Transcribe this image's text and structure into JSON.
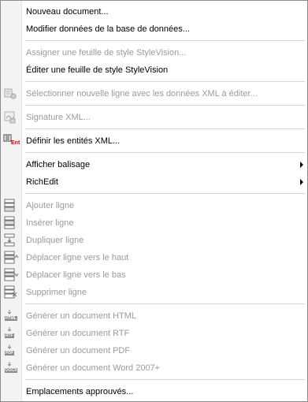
{
  "menu": {
    "new_document": "Nouveau document...",
    "edit_db_data": "Modifier données de la base de données...",
    "assign_stylesheet": "Assigner une feuille de style StyleVision...",
    "edit_stylesheet": "Éditer une feuille de style StyleVision",
    "select_new_row": "Sélectionner nouvelle ligne avec les données XML à éditer...",
    "signature": "Signature XML...",
    "define_entities": "Définir les entités XML...",
    "show_markup": "Afficher balisage",
    "richedit": "RichEdit",
    "add_row": "Ajouter ligne",
    "insert_row": "Insérer ligne",
    "duplicate_row": "Dupliquer ligne",
    "move_row_up": "Déplacer ligne vers le haut",
    "move_row_down": "Déplacer ligne vers le bas",
    "delete_row": "Supprimer ligne",
    "gen_html": "Générer un document HTML",
    "gen_rtf": "Générer un document RTF",
    "gen_pdf": "Générer un document PDF",
    "gen_word": "Générer un document Word 2007+",
    "trusted_locations": "Emplacements approuvés..."
  },
  "icons": {
    "ent_label": "Ent",
    "html_tag": "HTML",
    "rtf_tag": "RTF",
    "pdf_tag": "PDF",
    "docx_tag": "DOCX"
  },
  "colors": {
    "enabled_text": "#000000",
    "disabled_text": "#9a9a9a",
    "ent_red": "#d40000"
  }
}
